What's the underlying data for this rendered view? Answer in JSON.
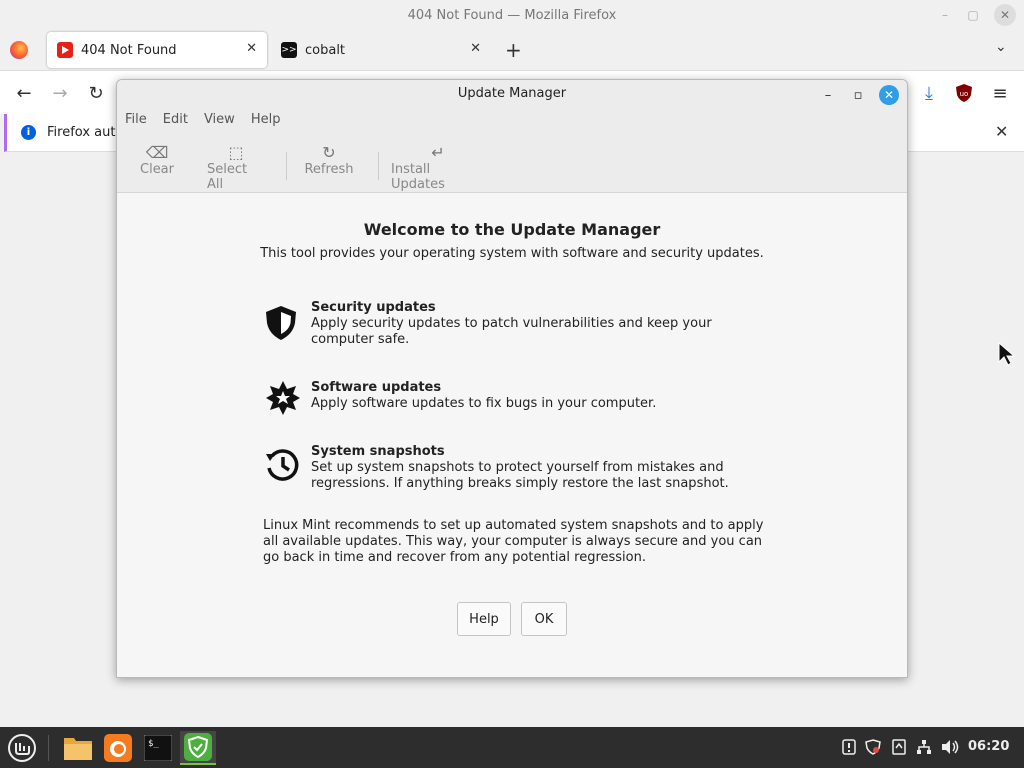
{
  "firefox": {
    "window_title": "404 Not Found — Mozilla Firefox",
    "tabs": [
      {
        "label": "404 Not Found",
        "icon": "youtube-icon",
        "active": true
      },
      {
        "label": "cobalt",
        "icon": "terminal-prompt-icon",
        "active": false
      }
    ],
    "notice_text": "Firefox auto"
  },
  "update_manager": {
    "title": "Update Manager",
    "menu": [
      "File",
      "Edit",
      "View",
      "Help"
    ],
    "toolbar": {
      "clear": "Clear",
      "select_all": "Select All",
      "refresh": "Refresh",
      "install_updates": "Install Updates"
    },
    "welcome_title": "Welcome to the Update Manager",
    "welcome_subtitle": "This tool provides your operating system with software and security updates.",
    "features": [
      {
        "icon": "shield-icon",
        "title": "Security updates",
        "description": "Apply security updates to patch vulnerabilities and keep your computer safe."
      },
      {
        "icon": "star-badge-icon",
        "title": "Software updates",
        "description": "Apply software updates to fix bugs in your computer."
      },
      {
        "icon": "history-icon",
        "title": "System snapshots",
        "description": "Set up system snapshots to protect yourself from mistakes and regressions. If anything breaks simply restore the last snapshot."
      }
    ],
    "recommendation": "Linux Mint recommends to set up automated system snapshots and to apply all available updates. This way, your computer is always secure and you can go back in time and recover from any potential regression.",
    "buttons": {
      "help": "Help",
      "ok": "OK"
    }
  },
  "taskbar": {
    "clock": "06:20",
    "accent_color": "#7fbf3f"
  }
}
